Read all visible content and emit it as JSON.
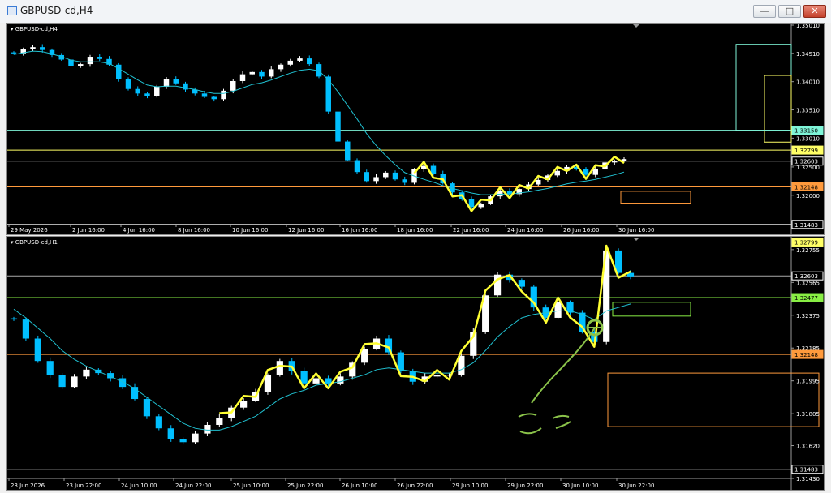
{
  "window": {
    "title": "GBPUSD-cd,H4",
    "minimize_icon": "minimize-icon",
    "maximize_icon": "maximize-icon",
    "close_icon": "close-icon"
  },
  "colors": {
    "background": "#000000",
    "price_axis_text": "#ffffff",
    "cyan_line": "#7ff5d8",
    "yellow_line": "#ffff66",
    "orange_line": "#ff9a3c",
    "green_line": "#88ee44",
    "white_line": "#e8e8e8",
    "bull_candle": "#ffffff",
    "bear_candle": "#00bfff",
    "moving_average": "#20c0d0",
    "hand_drawing_yellow": "#ffff33",
    "hand_drawing_green": "#8bc34a"
  },
  "chart_data": [
    {
      "type": "candlestick",
      "symbol_timeframe": "GBPUSD-cd,H4",
      "y_axis_ticks": [
        "1.35010",
        "1.34510",
        "1.34010",
        "1.33510",
        "1.33010",
        "1.32500",
        "1.32000"
      ],
      "ylim": [
        1.3148,
        1.3501
      ],
      "x_axis_ticks": [
        "29 May 2026",
        "2 Jun 16:00",
        "4 Jun 16:00",
        "8 Jun 16:00",
        "10 Jun 16:00",
        "12 Jun 16:00",
        "16 Jun 16:00",
        "18 Jun 16:00",
        "22 Jun 16:00",
        "24 Jun 16:00",
        "26 Jun 16:00",
        "30 Jun 16:00"
      ],
      "price_labels": [
        {
          "value": "1.33150",
          "color": "#7ff5d8"
        },
        {
          "value": "1.32799",
          "color": "#ffff66"
        },
        {
          "value": "1.32603",
          "color": "#ffffff"
        },
        {
          "value": "1.32148",
          "color": "#ff9a3c"
        },
        {
          "value": "1.31483",
          "color": "#ffffff"
        }
      ],
      "horizontal_lines": [
        {
          "price": 1.3315,
          "color": "#7ff5d8"
        },
        {
          "price": 1.32799,
          "color": "#ffff66"
        },
        {
          "price": 1.32603,
          "color": "#aaaaaa"
        },
        {
          "price": 1.32148,
          "color": "#ff9a3c"
        },
        {
          "price": 1.31483,
          "color": "#e8e8e8"
        }
      ],
      "zones": [
        {
          "color": "#7ff5d8",
          "from_price": 1.3467,
          "to_price": 1.3315
        },
        {
          "color": "#ffff66",
          "from_price": 1.3412,
          "to_price": 1.3294
        },
        {
          "color": "#ff9a3c",
          "from_price": 1.3207,
          "to_price": 1.3186
        }
      ],
      "close_path": [
        1.3451,
        1.3458,
        1.3462,
        1.3457,
        1.3448,
        1.344,
        1.3428,
        1.3432,
        1.3445,
        1.3441,
        1.3431,
        1.3405,
        1.3388,
        1.338,
        1.3375,
        1.3392,
        1.3405,
        1.3398,
        1.3387,
        1.338,
        1.3374,
        1.337,
        1.3385,
        1.3402,
        1.3414,
        1.3418,
        1.341,
        1.3423,
        1.3431,
        1.3438,
        1.3442,
        1.3432,
        1.341,
        1.3348,
        1.3295,
        1.3262,
        1.3241,
        1.3225,
        1.3232,
        1.324,
        1.3228,
        1.3222,
        1.3246,
        1.3252,
        1.3238,
        1.3221,
        1.3205,
        1.3193,
        1.3179,
        1.3185,
        1.3198,
        1.3207,
        1.3202,
        1.3211,
        1.3219,
        1.3227,
        1.3235,
        1.3243,
        1.325,
        1.3247,
        1.3236,
        1.3246,
        1.3258,
        1.3261,
        1.3264
      ],
      "ma_path": [
        1.3449,
        1.3452,
        1.3455,
        1.3454,
        1.345,
        1.3445,
        1.3439,
        1.3436,
        1.3436,
        1.3436,
        1.3433,
        1.3424,
        1.3414,
        1.3404,
        1.3395,
        1.3392,
        1.3393,
        1.3393,
        1.339,
        1.3387,
        1.3383,
        1.338,
        1.338,
        1.3384,
        1.339,
        1.3396,
        1.3399,
        1.3404,
        1.341,
        1.3416,
        1.3421,
        1.3423,
        1.342,
        1.3404,
        1.3383,
        1.3359,
        1.3335,
        1.3309,
        1.3288,
        1.327,
        1.3254,
        1.324,
        1.3234,
        1.3228,
        1.3223,
        1.3217,
        1.3212,
        1.3208,
        1.3204,
        1.3201,
        1.3201,
        1.3202,
        1.3202,
        1.3204,
        1.3206,
        1.3209,
        1.3212,
        1.3216,
        1.322,
        1.3223,
        1.3225,
        1.3228,
        1.3232,
        1.3236,
        1.3241
      ]
    },
    {
      "type": "candlestick",
      "symbol_timeframe": "GBPUSD-cd,H1",
      "y_axis_ticks": [
        "1.32755",
        "1.32565",
        "1.32375",
        "1.32185",
        "1.31995",
        "1.31805",
        "1.31620",
        "1.31430"
      ],
      "ylim": [
        1.3143,
        1.3282
      ],
      "x_axis_ticks": [
        "23 Jun 2026",
        "23 Jun 22:00",
        "24 Jun 10:00",
        "24 Jun 22:00",
        "25 Jun 10:00",
        "25 Jun 22:00",
        "26 Jun 10:00",
        "26 Jun 22:00",
        "29 Jun 10:00",
        "29 Jun 22:00",
        "30 Jun 10:00",
        "30 Jun 22:00"
      ],
      "price_labels": [
        {
          "value": "1.32799",
          "color": "#ffff66"
        },
        {
          "value": "1.32603",
          "color": "#ffffff"
        },
        {
          "value": "1.32477",
          "color": "#88ee44"
        },
        {
          "value": "1.32148",
          "color": "#ff9a3c"
        },
        {
          "value": "1.31483",
          "color": "#ffffff"
        }
      ],
      "horizontal_lines": [
        {
          "price": 1.32799,
          "color": "#ffff66"
        },
        {
          "price": 1.32603,
          "color": "#aaaaaa"
        },
        {
          "price": 1.32477,
          "color": "#88ee44"
        },
        {
          "price": 1.32148,
          "color": "#ff9a3c"
        },
        {
          "price": 1.31483,
          "color": "#e8e8e8"
        }
      ],
      "zones": [
        {
          "color": "#88ee44",
          "from_price": 1.3245,
          "to_price": 1.3237
        },
        {
          "color": "#ff9a3c",
          "from_price": 1.3204,
          "to_price": 1.3173
        }
      ],
      "close_path": [
        1.3235,
        1.3224,
        1.3211,
        1.3203,
        1.3196,
        1.3202,
        1.3206,
        1.3204,
        1.3201,
        1.3196,
        1.3189,
        1.3179,
        1.3172,
        1.3166,
        1.3164,
        1.3169,
        1.3174,
        1.3178,
        1.3184,
        1.3188,
        1.3193,
        1.3203,
        1.3211,
        1.3205,
        1.3198,
        1.3201,
        1.3198,
        1.3202,
        1.321,
        1.3218,
        1.3224,
        1.3216,
        1.3205,
        1.3199,
        1.3202,
        1.3203,
        1.3203,
        1.3214,
        1.3228,
        1.3249,
        1.3261,
        1.3258,
        1.3254,
        1.3242,
        1.3236,
        1.3245,
        1.3239,
        1.3228,
        1.3222,
        1.3275,
        1.3262,
        1.326
      ],
      "ma_path": [
        1.3241,
        1.3236,
        1.323,
        1.3224,
        1.3217,
        1.3212,
        1.3208,
        1.3205,
        1.3202,
        1.3199,
        1.3195,
        1.319,
        1.3185,
        1.318,
        1.3175,
        1.3172,
        1.3171,
        1.3171,
        1.3173,
        1.3176,
        1.3179,
        1.3184,
        1.3189,
        1.3192,
        1.3194,
        1.3197,
        1.3198,
        1.3199,
        1.3201,
        1.3203,
        1.3206,
        1.3207,
        1.3206,
        1.3205,
        1.3204,
        1.3204,
        1.3204,
        1.3206,
        1.321,
        1.3217,
        1.3225,
        1.3231,
        1.3236,
        1.3238,
        1.3239,
        1.324,
        1.324,
        1.3238,
        1.3235,
        1.324,
        1.3242,
        1.3244
      ]
    }
  ]
}
